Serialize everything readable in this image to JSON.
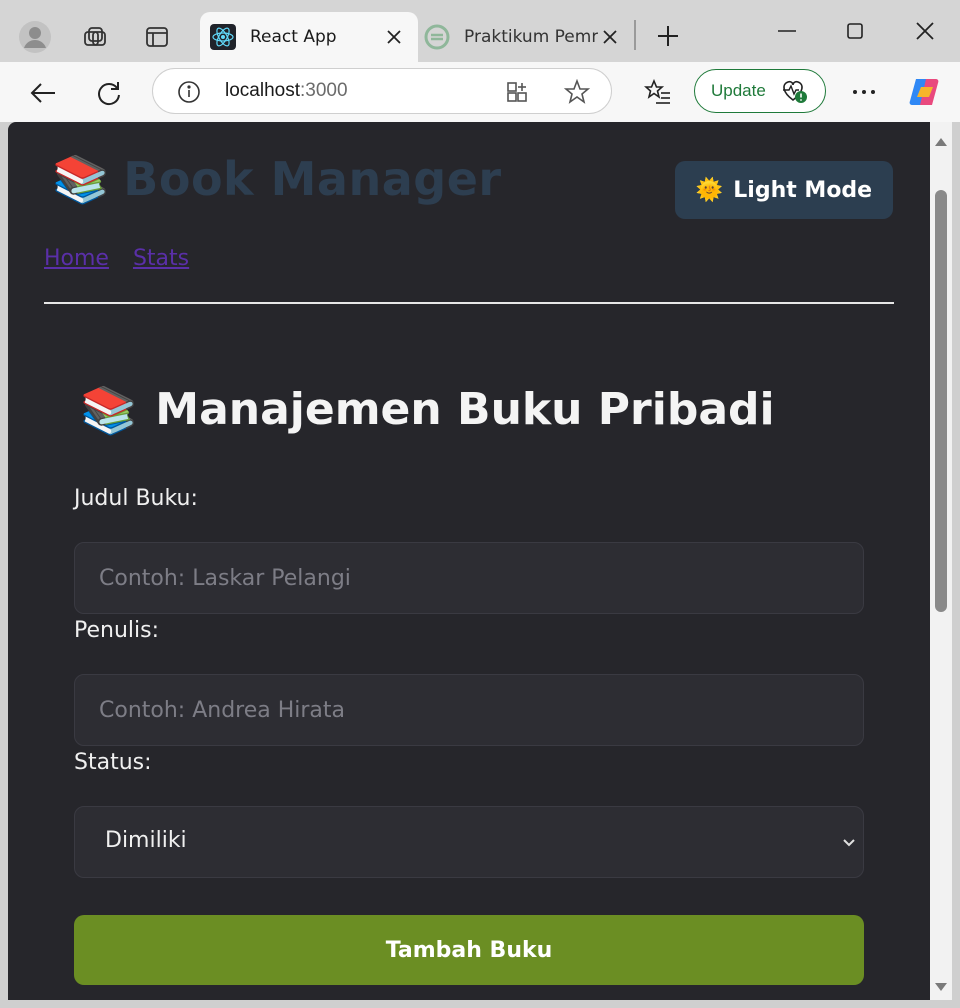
{
  "browser": {
    "tabs": [
      {
        "title": "React App",
        "active": true
      },
      {
        "title": "Praktikum Pemr",
        "active": false
      }
    ],
    "url": {
      "host": "localhost",
      "port": ":3000"
    },
    "update_label": "Update"
  },
  "app": {
    "brand_emoji": "📚",
    "brand_title": "Book Manager",
    "mode_button": {
      "emoji": "🌞",
      "label": "Light Mode"
    },
    "nav": [
      {
        "label": "Home"
      },
      {
        "label": "Stats"
      }
    ],
    "heading_emoji": "📚",
    "heading": "Manajemen Buku Pribadi",
    "form": {
      "title_label": "Judul Buku:",
      "title_placeholder": "Contoh: Laskar Pelangi",
      "author_label": "Penulis:",
      "author_placeholder": "Contoh: Andrea Hirata",
      "status_label": "Status:",
      "status_value": "Dimiliki",
      "submit_label": "Tambah Buku"
    }
  },
  "colors": {
    "page_bg": "#26262b",
    "brand": "#2d3e50",
    "mode_button_bg": "#2c3e50",
    "submit_bg": "#6b8e23",
    "nav_link": "#5a2fa8"
  }
}
